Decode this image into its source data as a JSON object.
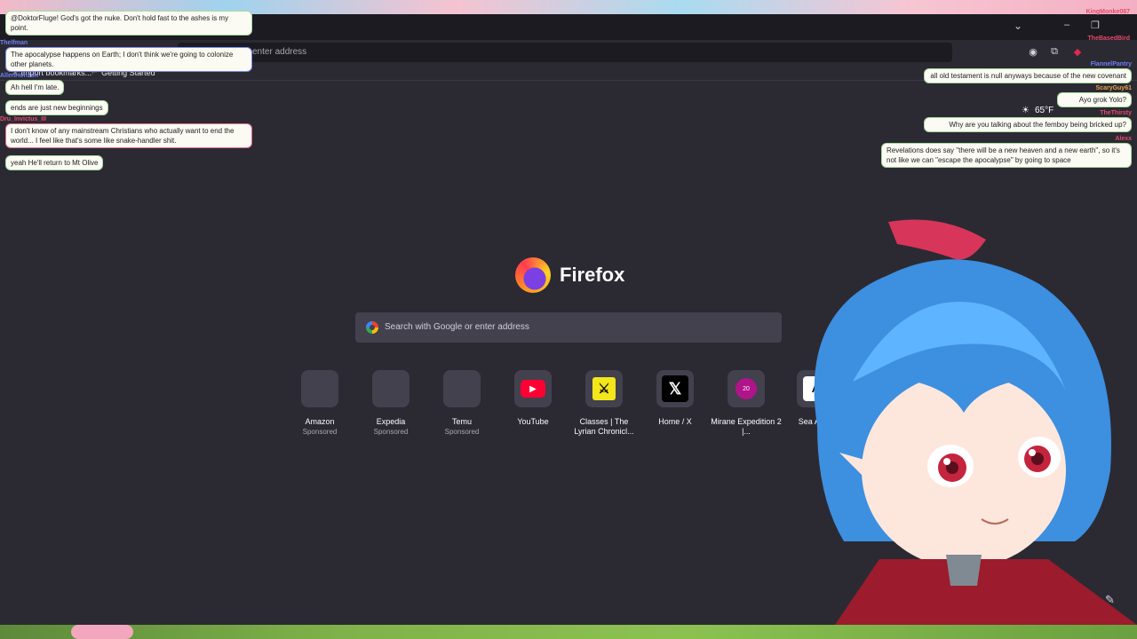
{
  "browser": {
    "url_placeholder": "enter address",
    "bookmarks": [
      "Import bookmarks...",
      "Getting Started"
    ]
  },
  "newtab": {
    "brand": "Firefox",
    "search_placeholder": "Search with Google or enter address",
    "tiles": [
      {
        "title": "Amazon",
        "sub": "Sponsored"
      },
      {
        "title": "Expedia",
        "sub": "Sponsored"
      },
      {
        "title": "Temu",
        "sub": "Sponsored"
      },
      {
        "title": "YouTube",
        "sub": ""
      },
      {
        "title": "Classes | The Lyrian Chronicl...",
        "sub": ""
      },
      {
        "title": "Home / X",
        "sub": ""
      },
      {
        "title": "Mirane Expedition 2 |...",
        "sub": ""
      },
      {
        "title": "Sea Anim",
        "sub": ""
      }
    ],
    "d20_label": "20"
  },
  "weather": {
    "temp": "65°F"
  },
  "chat_left": [
    {
      "user": "",
      "text": "@DoktorFluge! God's got the nuke. Don't hold fast to the ashes is my point."
    },
    {
      "user": "Thelfman",
      "text": "The apocalypse happens on Earth; I don't think we're going to colonize other planets."
    },
    {
      "user": "AllenHorizon",
      "text": "Ah hell I'm late."
    },
    {
      "user": "",
      "text": "ends are just new beginnings"
    },
    {
      "user": "Dru_Invictus_III",
      "text": "I don't know of any mainstream Christians who actually want to end the world... I feel like that's some like snake-handler shit."
    },
    {
      "user": "",
      "text": "yeah He'll return to Mt Olive"
    }
  ],
  "chat_right": [
    {
      "user": "KingMonke087",
      "text": ""
    },
    {
      "user": "TheBasedBird",
      "text": ""
    },
    {
      "user": "FlannelPantry",
      "text": "all old testament is null anyways because of the new covenant"
    },
    {
      "user": "ScaryGuy61",
      "text": "Ayo grok Yolo?"
    },
    {
      "user": "TheThirsty",
      "text": "Why are you talking about the femboy being bricked up?"
    },
    {
      "user": "Alexx",
      "text": "Revelations does say \"there will be a new heaven and a new earth\", so it's not like we can \"escape the apocalypse\" by going to space"
    }
  ],
  "colors": {
    "bg": "#2b2a33",
    "urlbar": "#1c1b22",
    "tile": "#42414d",
    "accent_pink": "#e86b8d",
    "accent_green": "#a8d8a0"
  }
}
